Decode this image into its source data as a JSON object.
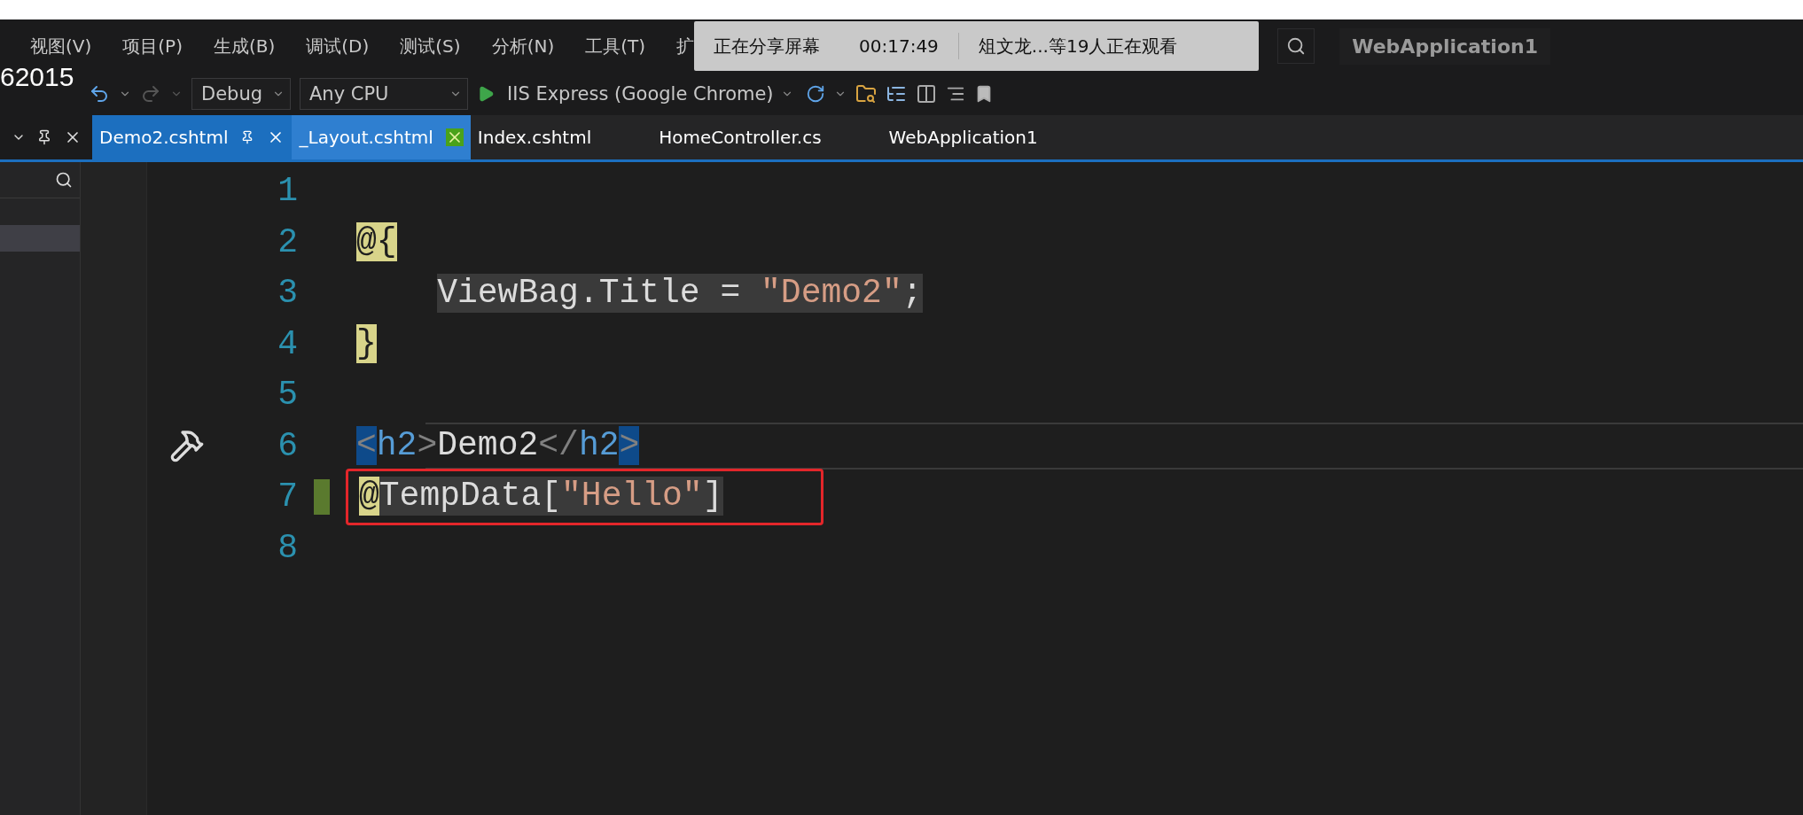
{
  "menu": [
    {
      "label": "视图(V)"
    },
    {
      "label": "项目(P)"
    },
    {
      "label": "生成(B)"
    },
    {
      "label": "调试(D)"
    },
    {
      "label": "测试(S)"
    },
    {
      "label": "分析(N)"
    },
    {
      "label": "工具(T)"
    },
    {
      "label": "扩"
    }
  ],
  "solution_title": "WebApplication1",
  "overlay_number": "62015",
  "share_banner": {
    "status": "正在分享屏幕",
    "time": "00:17:49",
    "viewers": "俎文龙...等19人正在观看"
  },
  "toolbar": {
    "configuration": "Debug",
    "platform": "Any CPU",
    "run_target": "IIS Express (Google Chrome)"
  },
  "tabs": [
    {
      "label": "Demo2.cshtml",
      "selected": true,
      "hovered": false
    },
    {
      "label": "_Layout.cshtml",
      "selected": false,
      "hovered": true
    },
    {
      "label": "Index.cshtml",
      "selected": false,
      "hovered": false
    },
    {
      "label": "HomeController.cs",
      "selected": false,
      "hovered": false
    },
    {
      "label": "WebApplication1",
      "selected": false,
      "hovered": false
    }
  ],
  "code_lines": [
    {
      "number": "1"
    },
    {
      "number": "2",
      "tokens": [
        {
          "text": "@",
          "kind": "razor"
        },
        {
          "text": "{",
          "kind": "razor"
        }
      ]
    },
    {
      "number": "3",
      "tokens": [
        {
          "kind": "indent"
        },
        {
          "text": "ViewBag.Title = ",
          "kind": "shaded"
        },
        {
          "text": "\"Demo2\"",
          "kind": "shaded-string"
        },
        {
          "text": ";",
          "kind": "shaded"
        }
      ]
    },
    {
      "number": "4",
      "tokens": [
        {
          "text": "}",
          "kind": "razor"
        }
      ]
    },
    {
      "number": "5"
    },
    {
      "number": "6",
      "tokens": [
        {
          "text": "<",
          "kind": "tag-bracket"
        },
        {
          "text": "h2",
          "kind": "tag-name"
        },
        {
          "text": ">",
          "kind": "delimiter"
        },
        {
          "text": "Demo2",
          "kind": "plain"
        },
        {
          "text": "</",
          "kind": "delimiter"
        },
        {
          "text": "h2",
          "kind": "tag-name"
        },
        {
          "text": ">",
          "kind": "tag-bracket"
        }
      ]
    },
    {
      "number": "7",
      "changed": true,
      "boxed": true,
      "tokens": [
        {
          "text": "@",
          "kind": "razor"
        },
        {
          "text": "TempData[",
          "kind": "shaded"
        },
        {
          "text": "\"Hello\"",
          "kind": "shaded-string"
        },
        {
          "text": "]",
          "kind": "shaded"
        }
      ]
    },
    {
      "number": "8"
    }
  ]
}
